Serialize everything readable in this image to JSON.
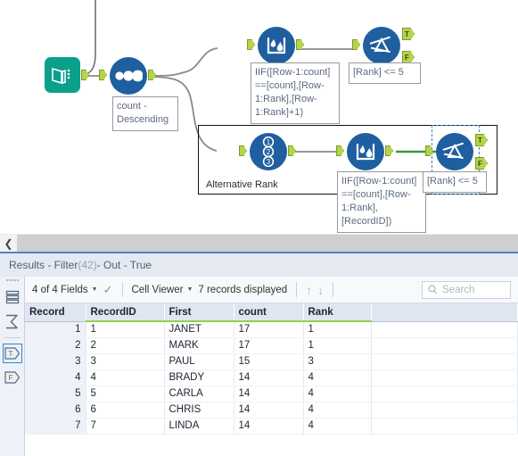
{
  "canvas": {
    "tools": [
      {
        "id": "input",
        "name": "input-data-tool",
        "icon": "book-icon"
      },
      {
        "id": "sort",
        "name": "sort-tool",
        "icon": "sort-dots-icon",
        "annotation": "count -\nDescending"
      },
      {
        "id": "mrf1",
        "name": "multi-row-formula-tool",
        "icon": "multi-row-formula-icon",
        "annotation": "IIF([Row-1:count]\n==[count],[Row-\n1:Rank],[Row-\n1:Rank]+1)"
      },
      {
        "id": "filter1",
        "name": "filter-tool",
        "icon": "filter-icon",
        "annotation": "[Rank] <= 5"
      },
      {
        "id": "recordid",
        "name": "record-id-tool",
        "icon": "record-id-icon"
      },
      {
        "id": "mrf2",
        "name": "multi-row-formula-tool",
        "icon": "multi-row-formula-icon",
        "annotation": "IIF([Row-1:count]\n==[count],[Row-\n1:Rank],\n[RecordID])"
      },
      {
        "id": "filter2",
        "name": "filter-tool-selected",
        "icon": "filter-icon",
        "annotation": "[Rank] <= 5"
      }
    ],
    "container_label": "Alternative Rank",
    "port_labels": {
      "true": "T",
      "false": "F"
    },
    "colors": {
      "tool_blue": "#1f5fa0",
      "tool_teal": "#0aa08c",
      "port_green": "#b5d34b",
      "active_wire": "#3a9a3a",
      "selection": "#2f86d6"
    }
  },
  "splitter": {
    "collapse_icon": "chevron-left-icon"
  },
  "results": {
    "title": "Results - Filter (42) - Out - True",
    "title_prefix": "Results - Filter ",
    "title_count": "(42)",
    "title_suffix": " - Out - True",
    "sidebar": [
      {
        "name": "data-rows-icon",
        "label": ""
      },
      {
        "name": "metadata-sigma-icon",
        "label": ""
      },
      {
        "name": "output-true-icon",
        "label": "T",
        "selected": true
      },
      {
        "name": "output-false-icon",
        "label": "F",
        "selected": false
      }
    ],
    "toolbar": {
      "fields_label": "4 of 4 Fields",
      "checkmark_icon": "checkmark-icon",
      "viewer_label": "Cell Viewer",
      "records_label": "7 records displayed",
      "up_arrow_icon": "arrow-up-icon",
      "down_arrow_icon": "arrow-down-icon",
      "search_icon": "search-icon",
      "search_placeholder": "Search"
    },
    "table": {
      "columns": [
        "Record",
        "RecordID",
        "First",
        "count",
        "Rank"
      ],
      "rows": [
        [
          "1",
          "1",
          "JANET",
          "17",
          "1"
        ],
        [
          "2",
          "2",
          "MARK",
          "17",
          "1"
        ],
        [
          "3",
          "3",
          "PAUL",
          "15",
          "3"
        ],
        [
          "4",
          "4",
          "BRADY",
          "14",
          "4"
        ],
        [
          "5",
          "5",
          "CARLA",
          "14",
          "4"
        ],
        [
          "6",
          "6",
          "CHRIS",
          "14",
          "4"
        ],
        [
          "7",
          "7",
          "LINDA",
          "14",
          "4"
        ]
      ]
    }
  }
}
